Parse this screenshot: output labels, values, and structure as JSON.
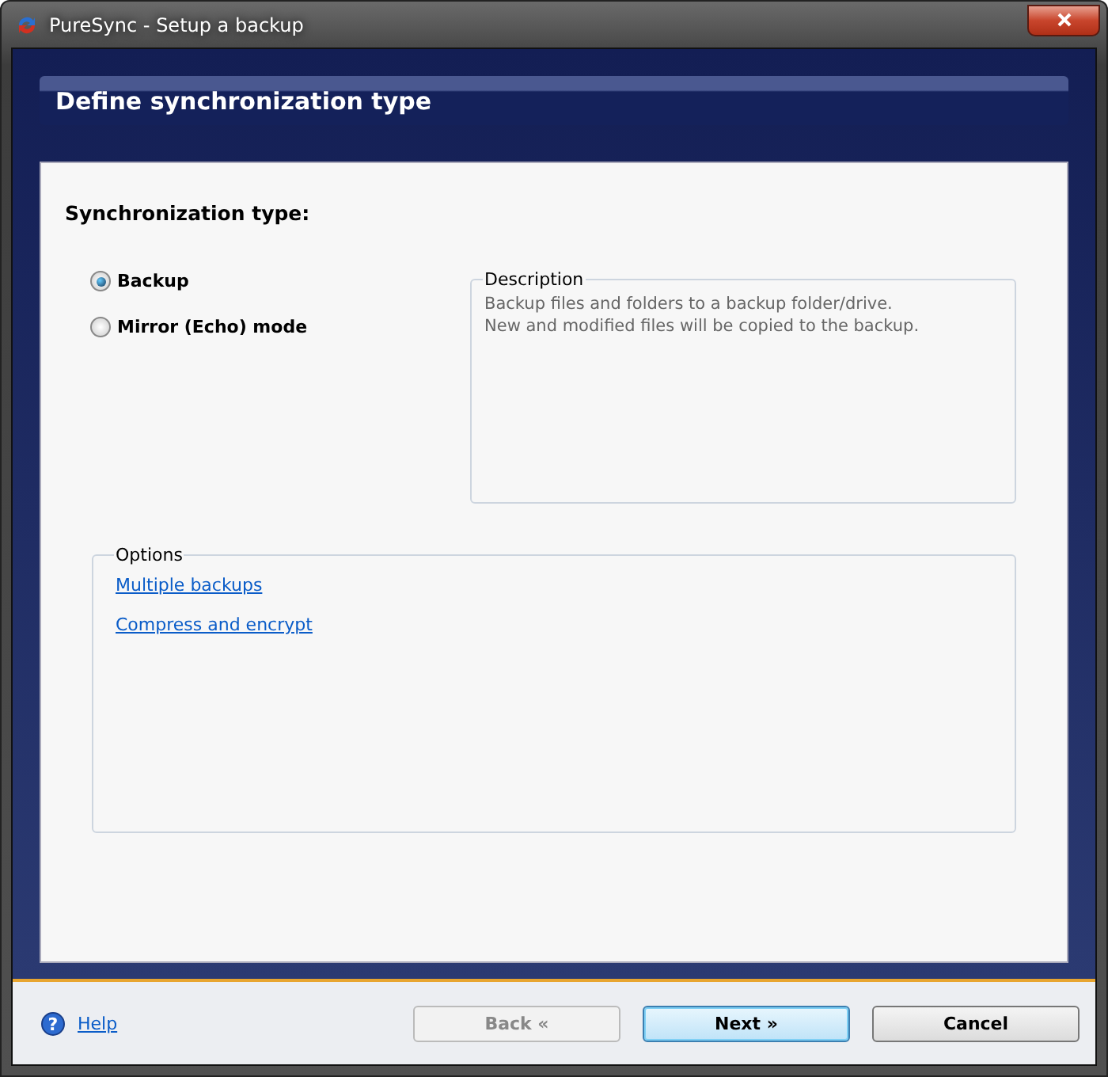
{
  "window": {
    "title": "PureSync - Setup a backup"
  },
  "header": {
    "title": "Define synchronization type"
  },
  "sync_type": {
    "label": "Synchronization type:",
    "options": [
      {
        "label": "Backup",
        "selected": true
      },
      {
        "label": "Mirror (Echo) mode",
        "selected": false
      }
    ]
  },
  "description": {
    "legend": "Description",
    "lines": [
      "Backup files and folders to a backup folder/drive.",
      "New and modified files will be copied to the backup."
    ]
  },
  "options": {
    "legend": "Options",
    "links": [
      "Multiple backups",
      "Compress and encrypt"
    ]
  },
  "footer": {
    "help_icon": "?",
    "help": "Help",
    "buttons": [
      {
        "label": "Back «",
        "disabled": true,
        "default": false
      },
      {
        "label": "Next »",
        "disabled": false,
        "default": true
      },
      {
        "label": "Cancel",
        "disabled": false,
        "default": false
      }
    ]
  }
}
